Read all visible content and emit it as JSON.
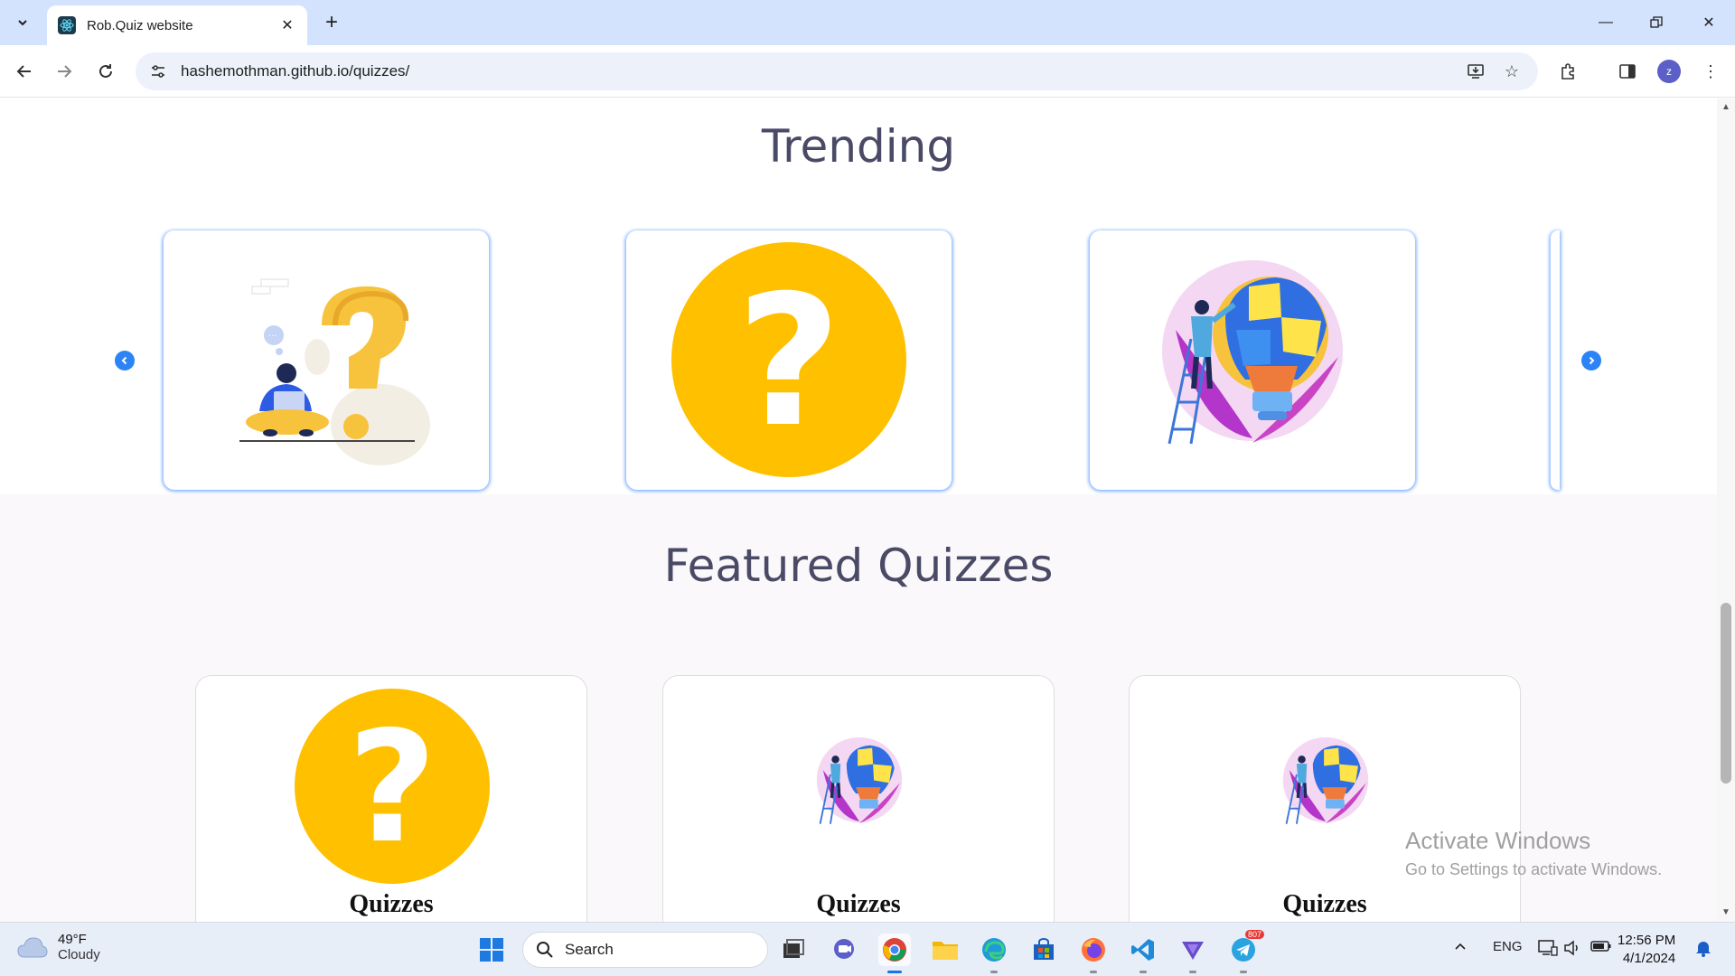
{
  "browser": {
    "tab_title": "Rob.Quiz website",
    "url": "hashemothman.github.io/quizzes/"
  },
  "page": {
    "trending_heading": "Trending",
    "featured_heading": "Featured Quizzes",
    "featured_cards": [
      {
        "label": "Quizzes",
        "image": "question-mark-circle"
      },
      {
        "label": "Quizzes",
        "image": "lightbulb-puzzle"
      },
      {
        "label": "Quizzes",
        "image": "lightbulb-puzzle"
      }
    ],
    "trending_cards": [
      {
        "image": "person-thinking-question-mark"
      },
      {
        "image": "question-mark-circle"
      },
      {
        "image": "lightbulb-puzzle"
      }
    ]
  },
  "watermark": {
    "line1": "Activate Windows",
    "line2": "Go to Settings to activate Windows."
  },
  "taskbar": {
    "weather_temp": "49°F",
    "weather_desc": "Cloudy",
    "search_placeholder": "Search",
    "telegram_badge": "807",
    "language": "ENG",
    "time": "12:56 PM",
    "date": "4/1/2024"
  },
  "colors": {
    "quiz_yellow": "#ffc000",
    "heading_color": "#4a4a66",
    "carousel_arrow": "#2b83f6"
  }
}
